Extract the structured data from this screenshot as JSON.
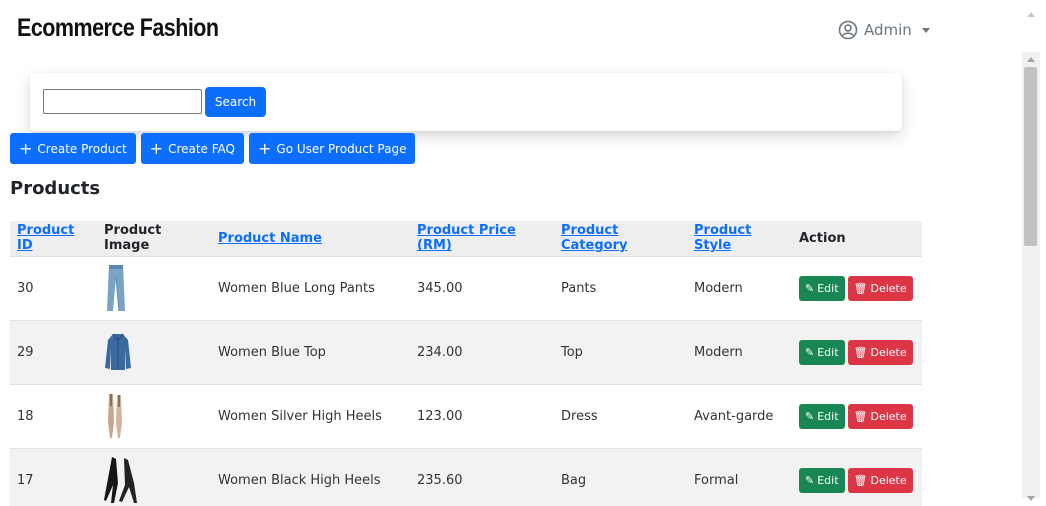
{
  "brand": "Ecommerce Fashion",
  "user": {
    "name": "Admin",
    "icon": "user-circle-icon"
  },
  "search": {
    "value": "",
    "placeholder": "",
    "button": "Search"
  },
  "actions": [
    {
      "label": "Create Product",
      "icon": "plus-icon"
    },
    {
      "label": "Create FAQ",
      "icon": "plus-icon"
    },
    {
      "label": "Go User Product Page",
      "icon": "plus-icon"
    }
  ],
  "section_title": "Products",
  "table": {
    "headers": [
      "Product ID",
      "Product Image",
      "Product Name",
      "Product Price (RM)",
      "Product Category",
      "Product Style",
      "Action"
    ],
    "rows": [
      {
        "id": "30",
        "image": "blue-jeans-image",
        "name": "Women Blue Long Pants",
        "price": "345.00",
        "category": "Pants",
        "style": "Modern"
      },
      {
        "id": "29",
        "image": "denim-jacket-image",
        "name": "Women Blue Top",
        "price": "234.00",
        "category": "Top",
        "style": "Modern"
      },
      {
        "id": "18",
        "image": "silver-heels-image",
        "name": "Women Silver High Heels",
        "price": "123.00",
        "category": "Dress",
        "style": "Avant-garde"
      },
      {
        "id": "17",
        "image": "black-heels-image",
        "name": "Women Black High Heels",
        "price": "235.60",
        "category": "Bag",
        "style": "Formal"
      }
    ],
    "edit_label": "Edit",
    "delete_label": "Delete"
  },
  "colors": {
    "primary": "#0d6efd",
    "success": "#198754",
    "danger": "#dc3545"
  }
}
